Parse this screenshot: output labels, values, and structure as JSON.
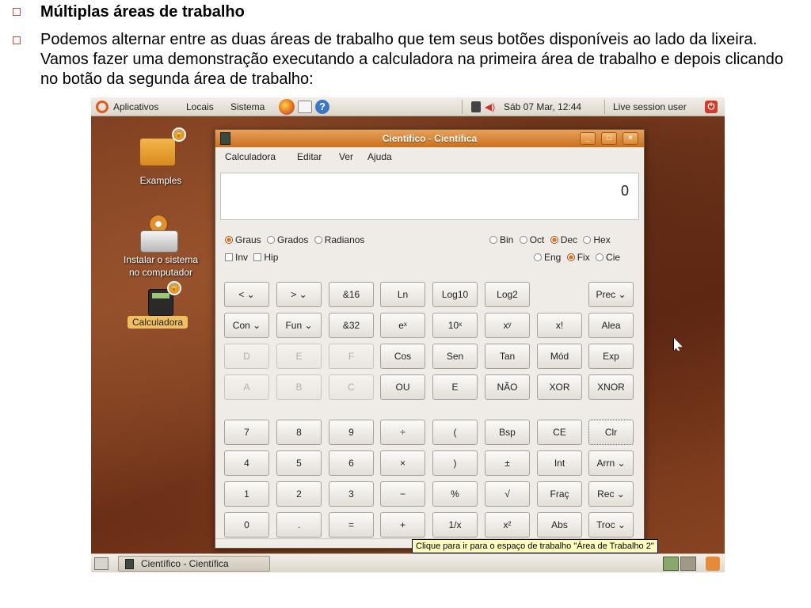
{
  "slide": {
    "heading": "Múltiplas áreas de trabalho",
    "paragraph": "Podemos alternar entre as duas áreas de trabalho que tem seus botões disponíveis ao lado da lixeira. Vamos fazer uma demonstração executando a calculadora na primeira área de trabalho e depois clicando no botão da segunda área de trabalho:"
  },
  "top_panel": {
    "menus": [
      "Aplicativos",
      "Locais",
      "Sistema"
    ],
    "clock": "Sáb 07 Mar, 12:44",
    "user": "Live session user",
    "icons": [
      "ubuntu-logo-icon",
      "firefox-icon",
      "mail-icon",
      "help-icon",
      "network-icon",
      "volume-icon",
      "power-icon"
    ]
  },
  "desktop": {
    "examples_label": "Examples",
    "installer_label_1": "Instalar o sistema",
    "installer_label_2": "no computador",
    "calculator_label": "Calculadora"
  },
  "window": {
    "title": "Científico - Científica",
    "buttons": [
      "_",
      "□",
      "×"
    ],
    "menu": [
      "Calculadora",
      "Editar",
      "Ver",
      "Ajuda"
    ],
    "display_value": "0",
    "angle_units": [
      "Graus",
      "Grados",
      "Radianos"
    ],
    "angle_selected": "Graus",
    "bases": [
      "Bin",
      "Oct",
      "Dec",
      "Hex"
    ],
    "base_selected": "Dec",
    "checks": [
      "Inv",
      "Hip"
    ],
    "notation": [
      "Eng",
      "Fix",
      "Cie"
    ],
    "notation_selected": "Fix"
  },
  "keys": {
    "row1": [
      "< ⌄",
      "> ⌄",
      "&16",
      "Ln",
      "Log10",
      "Log2",
      "",
      "Prec ⌄"
    ],
    "row2": [
      "Con ⌄",
      "Fun ⌄",
      "&32",
      "eˣ",
      "10ˣ",
      "xʸ",
      "x!",
      "Alea"
    ],
    "row3": [
      "D",
      "E",
      "F",
      "Cos",
      "Sen",
      "Tan",
      "Mód",
      "Exp"
    ],
    "row4": [
      "A",
      "B",
      "C",
      "OU",
      "E",
      "NÃO",
      "XOR",
      "XNOR"
    ],
    "row5": [
      "7",
      "8",
      "9",
      "÷",
      "(",
      "Bsp",
      "CE",
      "Clr"
    ],
    "row6": [
      "4",
      "5",
      "6",
      "×",
      ")",
      "±",
      "Int",
      "Arrn ⌄"
    ],
    "row7": [
      "1",
      "2",
      "3",
      "−",
      "%",
      "√",
      "Fraç",
      "Rec ⌄"
    ],
    "row8": [
      "0",
      ".",
      "=",
      "+",
      "1/x",
      "x²",
      "Abs",
      "Troc ⌄"
    ]
  },
  "tooltip": "Clique para ir para o espaço de trabalho \"Área de Trabalho 2\"",
  "taskbar": {
    "task_label": "Científico - Científica"
  }
}
